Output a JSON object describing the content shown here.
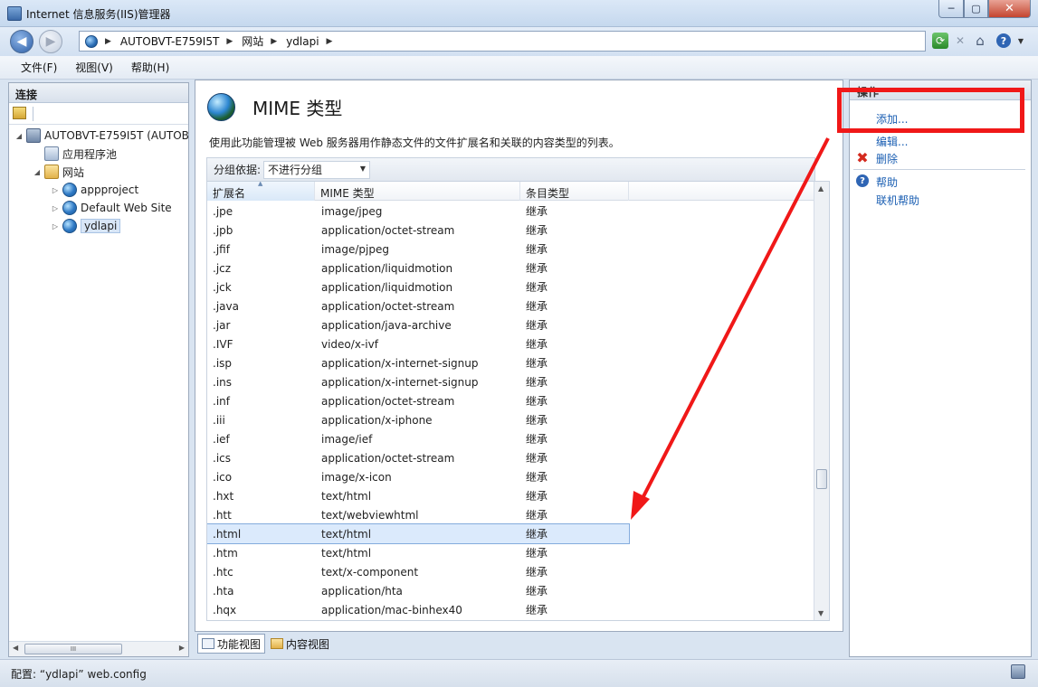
{
  "window": {
    "title": "Internet 信息服务(IIS)管理器",
    "min_glyph": "─",
    "max_glyph": "▢",
    "close_glyph": "✕"
  },
  "address": {
    "crumbs": [
      "AUTOBVT-E759I5T",
      "网站",
      "ydlapi"
    ],
    "sep_glyph": "▶"
  },
  "menu": [
    "文件(F)",
    "视图(V)",
    "帮助(H)"
  ],
  "connections": {
    "title": "连接",
    "tree": [
      {
        "label": "AUTOBVT-E759I5T (AUTOB",
        "icon": "server-icon",
        "expander": "◢"
      },
      {
        "label": "应用程序池",
        "icon": "app-pool-icon",
        "expander": ""
      },
      {
        "label": "网站",
        "icon": "sites-folder-icon",
        "expander": "◢"
      },
      {
        "label": "appproject",
        "icon": "site-globe-icon",
        "expander": "▷"
      },
      {
        "label": "Default Web Site",
        "icon": "site-globe-icon",
        "expander": "▷"
      },
      {
        "label": "ydlapi",
        "icon": "site-globe-icon",
        "expander": "▷"
      }
    ],
    "hscroll_thumb": "III"
  },
  "page": {
    "title": "MIME 类型",
    "description": "使用此功能管理被 Web 服务器用作静态文件的文件扩展名和关联的内容类型的列表。",
    "group_label": "分组依据:",
    "group_value": "不进行分组",
    "columns": [
      "扩展名",
      "MIME 类型",
      "条目类型"
    ],
    "rows": [
      [
        ".jpe",
        "image/jpeg",
        "继承"
      ],
      [
        ".jpb",
        "application/octet-stream",
        "继承"
      ],
      [
        ".jfif",
        "image/pjpeg",
        "继承"
      ],
      [
        ".jcz",
        "application/liquidmotion",
        "继承"
      ],
      [
        ".jck",
        "application/liquidmotion",
        "继承"
      ],
      [
        ".java",
        "application/octet-stream",
        "继承"
      ],
      [
        ".jar",
        "application/java-archive",
        "继承"
      ],
      [
        ".IVF",
        "video/x-ivf",
        "继承"
      ],
      [
        ".isp",
        "application/x-internet-signup",
        "继承"
      ],
      [
        ".ins",
        "application/x-internet-signup",
        "继承"
      ],
      [
        ".inf",
        "application/octet-stream",
        "继承"
      ],
      [
        ".iii",
        "application/x-iphone",
        "继承"
      ],
      [
        ".ief",
        "image/ief",
        "继承"
      ],
      [
        ".ics",
        "application/octet-stream",
        "继承"
      ],
      [
        ".ico",
        "image/x-icon",
        "继承"
      ],
      [
        ".hxt",
        "text/html",
        "继承"
      ],
      [
        ".htt",
        "text/webviewhtml",
        "继承"
      ],
      [
        ".html",
        "text/html",
        "继承"
      ],
      [
        ".htm",
        "text/html",
        "继承"
      ],
      [
        ".htc",
        "text/x-component",
        "继承"
      ],
      [
        ".hta",
        "application/hta",
        "继承"
      ],
      [
        ".hqx",
        "application/mac-binhex40",
        "继承"
      ]
    ],
    "selected_row": 17
  },
  "view_tabs": {
    "features": "功能视图",
    "content": "内容视图"
  },
  "actions": {
    "title": "操作",
    "add": "添加...",
    "edit": "编辑...",
    "delete": "删除",
    "help": "帮助",
    "online_help": "联机帮助"
  },
  "status": {
    "text": "配置: “ydlapi” web.config"
  },
  "colors": {
    "annotation_red": "#f01818",
    "link_blue": "#1b5fb3",
    "selection": "#dbeafc"
  }
}
